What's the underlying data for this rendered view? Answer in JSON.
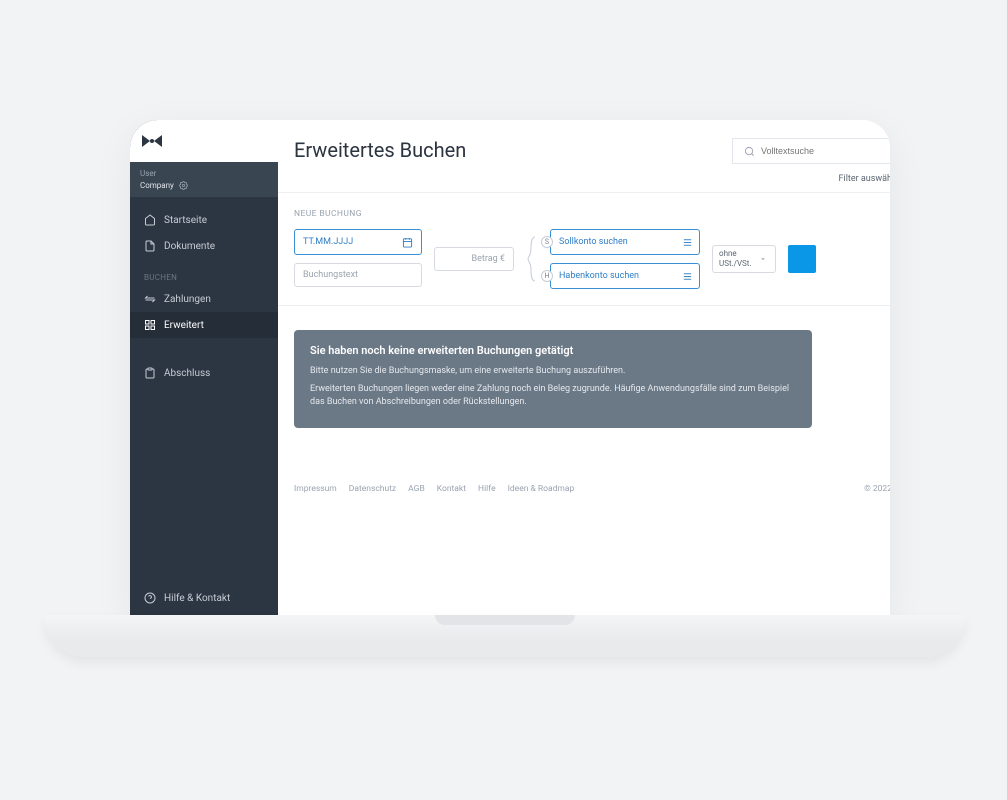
{
  "user": {
    "label": "User",
    "company": "Company"
  },
  "sidebar": {
    "section": "BUCHEN",
    "items": [
      {
        "label": "Startseite"
      },
      {
        "label": "Dokumente"
      },
      {
        "label": "Zahlungen"
      },
      {
        "label": "Erweitert"
      },
      {
        "label": "Abschluss"
      }
    ],
    "help": "Hilfe & Kontakt"
  },
  "header": {
    "title": "Erweitertes Buchen",
    "search_placeholder": "Volltextsuche",
    "filter": "Filter auswäh"
  },
  "form": {
    "title": "NEUE BUCHUNG",
    "date_placeholder": "TT.MM.JJJJ",
    "text_placeholder": "Buchungstext",
    "amount_placeholder": "Betrag €",
    "soll_placeholder": "Sollkonto suchen",
    "haben_placeholder": "Habenkonto suchen",
    "soll_badge": "S",
    "haben_badge": "H",
    "tax_label": "ohne USt./VSt."
  },
  "info": {
    "title": "Sie haben noch keine erweiterten Buchungen getätigt",
    "line1": "Bitte nutzen Sie die Buchungsmaske, um eine erweiterte Buchung auszuführen.",
    "line2": "Erweiterten Buchungen liegen weder eine Zahlung noch ein Beleg zugrunde. Häufige Anwendungsfälle sind zum Beispiel das Buchen von Abschreibungen oder Rückstellungen."
  },
  "footer": {
    "links": [
      "Impressum",
      "Datenschutz",
      "AGB",
      "Kontakt",
      "Hilfe",
      "Ideen & Roadmap"
    ],
    "copy": "© 2022"
  }
}
